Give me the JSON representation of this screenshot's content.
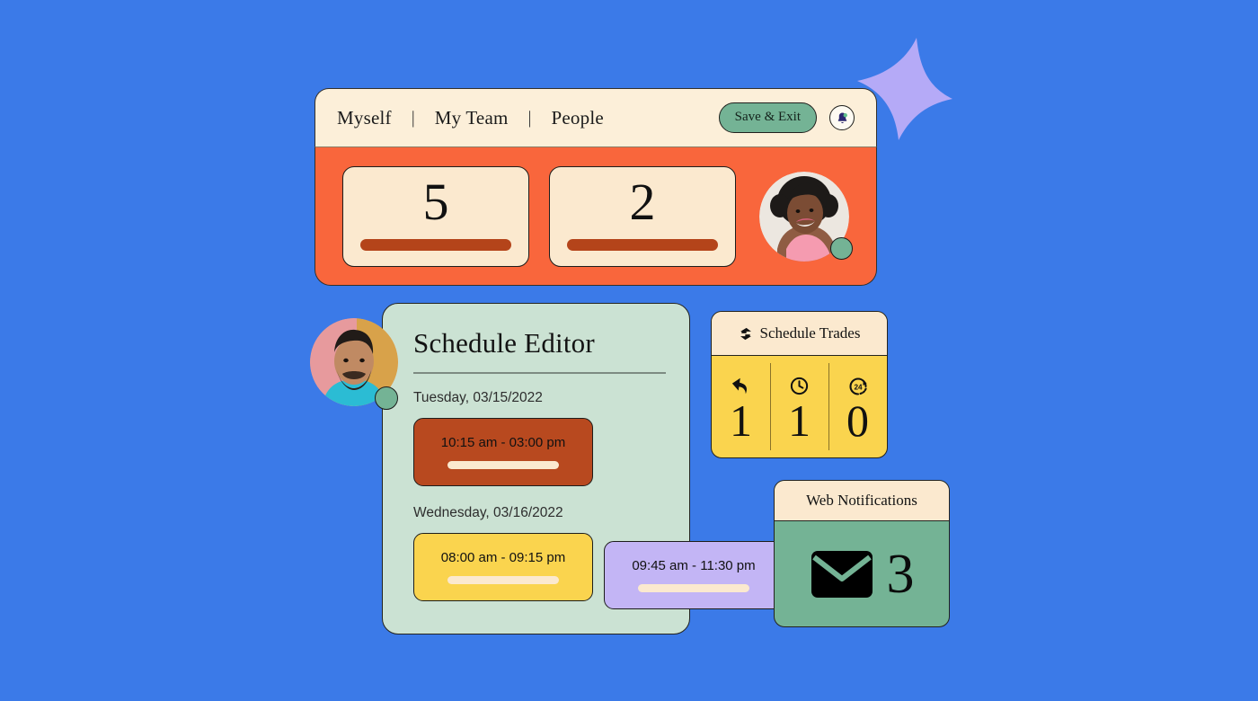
{
  "theme": {
    "background": "#3b7ae8",
    "cream": "#fbe9cf",
    "orange": "#f9663c",
    "green": "#74b395",
    "yellow": "#fad44e",
    "purple": "#c3b5f5",
    "rust": "#b8491f",
    "mint": "#cbe2d3"
  },
  "decoration": {
    "sparkle": "sparkle-shape"
  },
  "app": {
    "nav": {
      "items": [
        {
          "label": "Myself"
        },
        {
          "label": "My Team"
        },
        {
          "label": "People"
        }
      ],
      "separator": "|"
    },
    "actions": {
      "save_label": "Save & Exit",
      "bell_icon": "bell-icon"
    },
    "stats": [
      {
        "value": "5"
      },
      {
        "value": "2"
      }
    ],
    "avatar": {
      "name": "user-avatar",
      "status": "online"
    }
  },
  "schedule_editor": {
    "title": "Schedule Editor",
    "avatar": {
      "name": "employee-avatar",
      "status": "online"
    },
    "days": [
      {
        "date": "Tuesday, 03/15/2022",
        "shifts": [
          {
            "time": "10:15 am - 03:00 pm",
            "color": "rust"
          }
        ]
      },
      {
        "date": "Wednesday, 03/16/2022",
        "shifts": [
          {
            "time": "08:00 am - 09:15 pm",
            "color": "yellow"
          },
          {
            "time": "09:45 am - 11:30 pm",
            "color": "purple"
          }
        ]
      }
    ]
  },
  "schedule_trades": {
    "title": "Schedule Trades",
    "header_icon": "swap-arrows-icon",
    "columns": [
      {
        "icon": "reply-arrow-icon",
        "value": "1"
      },
      {
        "icon": "clock-icon",
        "value": "1"
      },
      {
        "icon": "24-hour-icon",
        "value": "0"
      }
    ]
  },
  "web_notifications": {
    "title": "Web Notifications",
    "icon": "envelope-icon",
    "count": "3"
  }
}
